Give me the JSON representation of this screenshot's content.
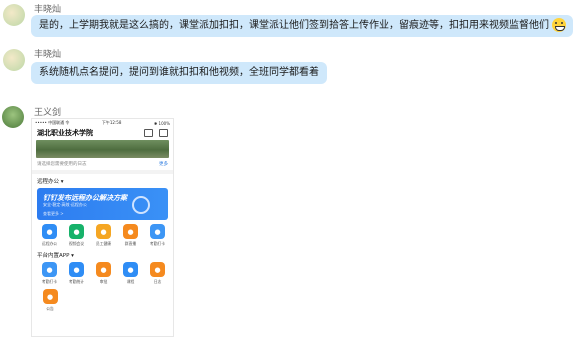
{
  "messages": [
    {
      "sender": "丰晓灿",
      "text": "是的，上学期我就是这么搞的，课堂派加扣扣，课堂派让他们签到拾答上传作业，留痕迹等，扣扣用来视频监督他们"
    },
    {
      "sender": "丰晓灿",
      "text": "系统随机点名提问，提问到谁就扣扣和他视频，全班同学都看着"
    },
    {
      "sender": "王义剑",
      "text": ""
    }
  ],
  "phone": {
    "status_left": "••••• 中国联通 令",
    "status_time": "下午12:58",
    "status_right": "✱ 100%",
    "title": "湖北职业技术学院",
    "notice": "请选择您需要使用的日志",
    "notice_more": "更多",
    "section1": "远程办公 ▾",
    "banner_title": "钉钉发布远程办公解决方案",
    "banner_sub": "安全·稳定·高效·远程办公",
    "banner_link": "查看更多 >",
    "apps_row1": [
      {
        "label": "远程办公",
        "color": "#2f8df5",
        "icon": "cloud-icon"
      },
      {
        "label": "视频会议",
        "color": "#17b26a",
        "icon": "video-icon"
      },
      {
        "label": "员工健康",
        "color": "#f5a623",
        "icon": "heart-icon"
      },
      {
        "label": "群直播",
        "color": "#f58a1f",
        "icon": "live-icon"
      },
      {
        "label": "考勤打卡",
        "color": "#3d96f5",
        "icon": "clock-icon"
      }
    ],
    "section2": "平台内置APP ▾",
    "apps_row2": [
      {
        "label": "考勤打卡",
        "color": "#3d96f5",
        "icon": "clock-icon"
      },
      {
        "label": "考勤统计",
        "color": "#2f8df5",
        "icon": "chart-icon"
      },
      {
        "label": "审批",
        "color": "#f58a1f",
        "icon": "approve-icon"
      },
      {
        "label": "课程",
        "color": "#2f8df5",
        "icon": "course-icon"
      },
      {
        "label": "日志",
        "color": "#f58a1f",
        "icon": "log-icon"
      }
    ],
    "apps_row3": [
      {
        "label": "公告",
        "color": "#f58a1f",
        "icon": "announce-icon"
      }
    ]
  }
}
